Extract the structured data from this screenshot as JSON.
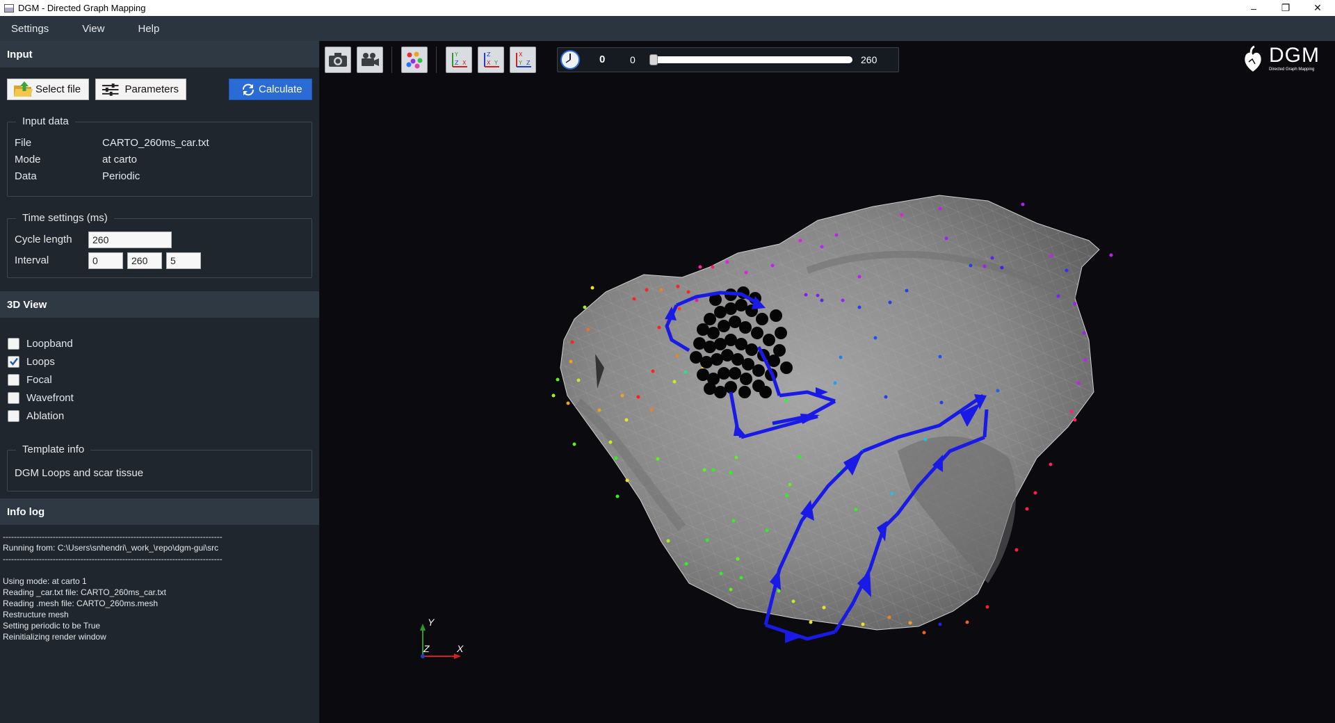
{
  "window": {
    "title": "DGM - Directed Graph Mapping",
    "controls": [
      "–",
      "❐",
      "✕"
    ]
  },
  "menu": [
    "Settings",
    "View",
    "Help"
  ],
  "input": {
    "header": "Input",
    "select_file_label": "Select file",
    "parameters_label": "Parameters",
    "calculate_label": "Calculate",
    "input_data": {
      "title": "Input data",
      "rows": [
        {
          "key": "File",
          "value": "CARTO_260ms_car.txt"
        },
        {
          "key": "Mode",
          "value": "at carto"
        },
        {
          "key": "Data",
          "value": "Periodic"
        }
      ]
    },
    "time_settings": {
      "title": "Time settings (ms)",
      "cycle_length_label": "Cycle length",
      "cycle_length": "260",
      "interval_label": "Interval",
      "interval_start": "0",
      "interval_end": "260",
      "interval_step": "5"
    }
  },
  "view3d": {
    "header": "3D View",
    "options": [
      {
        "label": "Loopband",
        "checked": false
      },
      {
        "label": "Loops",
        "checked": true
      },
      {
        "label": "Focal",
        "checked": false
      },
      {
        "label": "Wavefront",
        "checked": false
      },
      {
        "label": "Ablation",
        "checked": false
      }
    ],
    "template_info": {
      "title": "Template info",
      "text": "DGM Loops and scar tissue"
    }
  },
  "info_log": {
    "header": "Info log",
    "lines": [
      "-------------------------------------------------------------------------------",
      "Running from: C:\\Users\\snhendri\\_work_\\repo\\dgm-gui\\src",
      "-------------------------------------------------------------------------------",
      "",
      "Using mode: at carto 1",
      "Reading _car.txt file: CARTO_260ms_car.txt",
      "Reading .mesh file: CARTO_260ms.mesh",
      "Restructure mesh",
      "Setting periodic to be True",
      "Reinitializing render window"
    ]
  },
  "toolbar": {
    "tools": [
      "camera-icon",
      "video-camera-icon",
      "color-points-icon",
      "view-xy-icon",
      "view-xz-icon",
      "view-yz-icon"
    ],
    "time_value": "0",
    "slider_min": "0",
    "slider_max": "260",
    "slider_position": 0
  },
  "logo": {
    "name": "DGM",
    "subtitle": "Directed Graph Mapping"
  },
  "axes": {
    "x": "X",
    "y": "Y",
    "z": "Z"
  },
  "colors": {
    "accent": "#2b6bd6",
    "loop_arrows": "#1a1ae6",
    "scar": "#000000",
    "mesh": "#8a8a8a"
  }
}
